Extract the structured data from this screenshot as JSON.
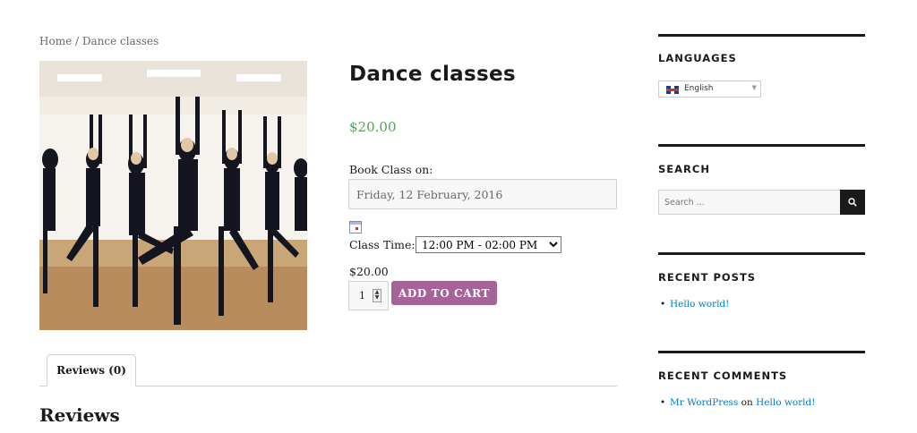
{
  "breadcrumb": {
    "home": "Home",
    "separator": " / ",
    "current": "Dance classes"
  },
  "product": {
    "image_name": "dance-class-photo",
    "title": "Dance classes",
    "price": "$20.00",
    "book_label": "Book Class on:",
    "date_value": "Friday, 12 February, 2016",
    "time_label": "Class Time:",
    "time_selected": "12:00 PM - 02:00 PM",
    "sub_price": "$20.00",
    "quantity": "1",
    "add_to_cart": "ADD TO CART"
  },
  "tabs": [
    {
      "label": "Reviews (0)"
    }
  ],
  "reviews_heading": "Reviews",
  "sidebar": {
    "languages": {
      "title": "LANGUAGES",
      "selected": "English"
    },
    "search": {
      "title": "SEARCH",
      "placeholder": "Search ..."
    },
    "recent_posts": {
      "title": "RECENT POSTS",
      "items": [
        {
          "label": "Hello world!"
        }
      ]
    },
    "recent_comments": {
      "title": "RECENT COMMENTS",
      "items": [
        {
          "author": "Mr WordPress",
          "connector": "on",
          "post": "Hello world!"
        }
      ]
    }
  },
  "colors": {
    "price": "#5a9f5a",
    "add_to_cart": "#a46497",
    "link": "#007acc",
    "rule": "#1a1a1a"
  }
}
